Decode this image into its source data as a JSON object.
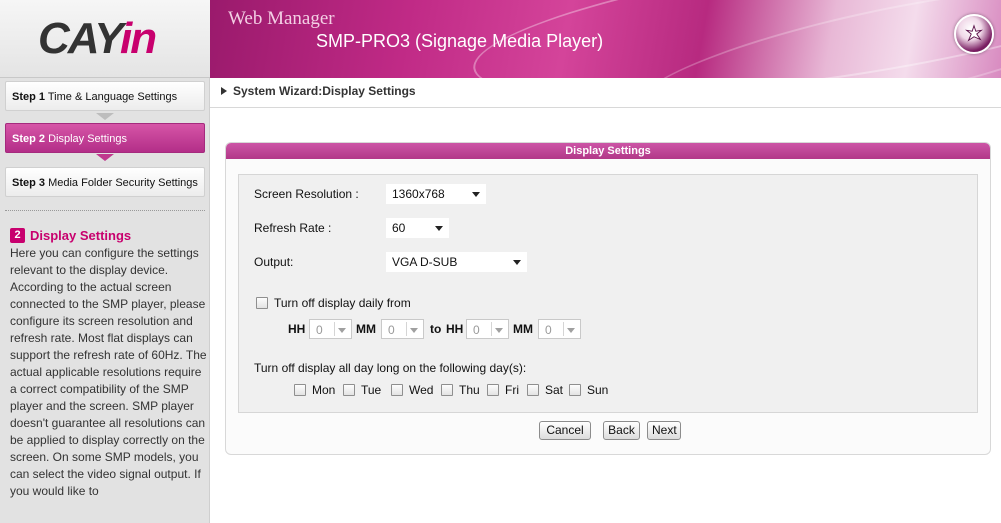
{
  "header": {
    "logo_text_main": "CAY",
    "logo_text_accent": "in",
    "app_title": "Web Manager",
    "device_name": "SMP-PRO3 (Signage Media Player)"
  },
  "sidebar": {
    "steps": [
      {
        "num": "Step 1",
        "label": "Time & Language Settings",
        "active": false
      },
      {
        "num": "Step 2",
        "label": "Display Settings",
        "active": true
      },
      {
        "num": "Step 3",
        "label": "Media Folder Security Settings",
        "active": false
      }
    ],
    "help": {
      "badge": "2",
      "title": "Display Settings",
      "body": "Here you can configure the settings relevant to the display device. According to the actual screen connected to the SMP player, please configure its screen resolution and refresh rate. Most flat displays can support the refresh rate of 60Hz. The actual applicable resolutions require a correct compatibility of the SMP player and the screen. SMP player doesn't guarantee all resolutions can be applied to display correctly on the screen. On some SMP models, you can select the video signal output. If you would like to"
    }
  },
  "breadcrumb": "System Wizard:Display Settings",
  "panel": {
    "title": "Display Settings",
    "screen_resolution": {
      "label": "Screen Resolution :",
      "value": "1360x768"
    },
    "refresh_rate": {
      "label": "Refresh Rate :",
      "value": "60"
    },
    "output": {
      "label": "Output:",
      "value": "VGA D-SUB"
    },
    "turn_off_daily": {
      "label": "Turn off display daily from",
      "hh": "HH",
      "mm": "MM",
      "to": "to",
      "from_hh": "0",
      "from_mm": "0",
      "to_hh": "0",
      "to_mm": "0"
    },
    "turn_off_days": {
      "label": "Turn off display all day long on the following day(s):",
      "days": [
        "Mon",
        "Tue",
        "Wed",
        "Thu",
        "Fri",
        "Sat",
        "Sun"
      ]
    }
  },
  "buttons": {
    "cancel": "Cancel",
    "back": "Back",
    "next": "Next"
  },
  "colors": {
    "accent": "#c8006e",
    "active_step": "#c0388e",
    "panel_header": "#b23888"
  }
}
